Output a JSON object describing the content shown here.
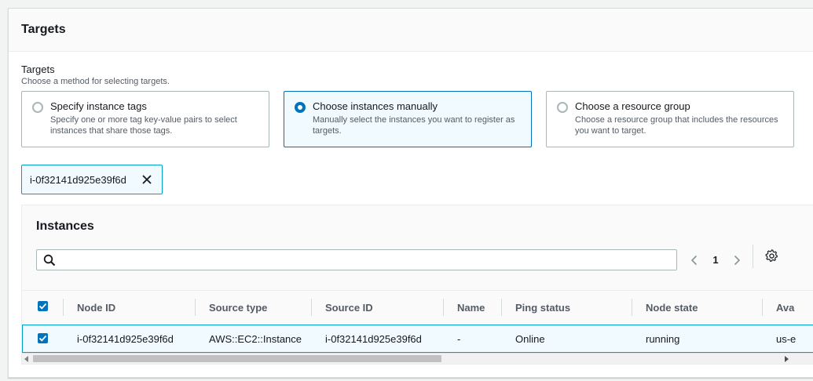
{
  "panel": {
    "title": "Targets"
  },
  "targets": {
    "label": "Targets",
    "description": "Choose a method for selecting targets.",
    "options": [
      {
        "title": "Specify instance tags",
        "description": "Specify one or more tag key-value pairs to select instances that share those tags.",
        "selected": false
      },
      {
        "title": "Choose instances manually",
        "description": "Manually select the instances you want to register as targets.",
        "selected": true
      },
      {
        "title": "Choose a resource group",
        "description": "Choose a resource group that includes the resources you want to target.",
        "selected": false
      }
    ]
  },
  "token": {
    "label": "i-0f32141d925e39f6d"
  },
  "instances": {
    "title": "Instances",
    "search": {
      "value": "",
      "placeholder": ""
    },
    "pager": {
      "page": "1"
    },
    "columns": [
      "Node ID",
      "Source type",
      "Source ID",
      "Name",
      "Ping status",
      "Node state",
      "Ava"
    ],
    "rows": [
      {
        "selected": true,
        "cells": [
          "i-0f32141d925e39f6d",
          "AWS::EC2::Instance",
          "i-0f32141d925e39f6d",
          "-",
          "Online",
          "running",
          "us-e"
        ]
      }
    ]
  },
  "colors": {
    "accent": "#0073bb",
    "selected_border": "#00a1c9",
    "selected_bg": "#f1faff"
  },
  "icons": {
    "search": "search-icon",
    "close": "close-icon",
    "prev": "chevron-left-icon",
    "next": "chevron-right-icon",
    "settings": "gear-icon",
    "check": "check-icon"
  }
}
